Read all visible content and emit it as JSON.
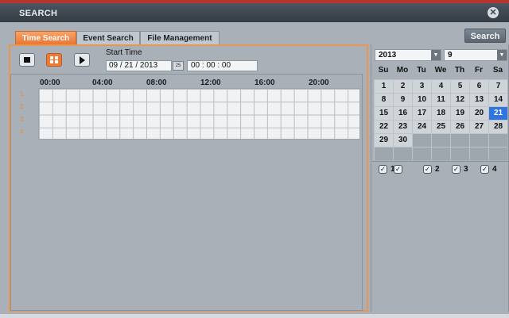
{
  "window": {
    "title": "SEARCH"
  },
  "tabs": [
    {
      "label": "Time Search",
      "active": true
    },
    {
      "label": "Event Search",
      "active": false
    },
    {
      "label": "File Management",
      "active": false
    }
  ],
  "search_button": "Search",
  "time_search": {
    "start_time_label": "Start Time",
    "date_value": "09 / 21 / 2013",
    "date_picker_icon": "25",
    "time_value": "00  :  00  :  00",
    "controls": [
      "stop-icon",
      "grid-view-icon",
      "play-icon"
    ]
  },
  "timeline": {
    "hours": [
      "00:00",
      "04:00",
      "08:00",
      "12:00",
      "16:00",
      "20:00"
    ],
    "channels": [
      "1",
      "2",
      "3",
      "4"
    ]
  },
  "calendar": {
    "year": "2013",
    "month": "9",
    "weekdays": [
      "Su",
      "Mo",
      "Tu",
      "We",
      "Th",
      "Fr",
      "Sa"
    ],
    "days": [
      "1",
      "2",
      "3",
      "4",
      "5",
      "6",
      "7",
      "8",
      "9",
      "10",
      "11",
      "12",
      "13",
      "14",
      "15",
      "16",
      "17",
      "18",
      "19",
      "20",
      "21",
      "22",
      "23",
      "24",
      "25",
      "26",
      "27",
      "28",
      "29",
      "30"
    ],
    "first_weekday": 0,
    "selected_day": "21",
    "channels": [
      "1",
      "2",
      "3",
      "4"
    ]
  },
  "colors": {
    "accent": "#ea7633",
    "titlebar": "#3c444e",
    "selected_day": "#2f74e0",
    "background": "#a9b0b7"
  }
}
